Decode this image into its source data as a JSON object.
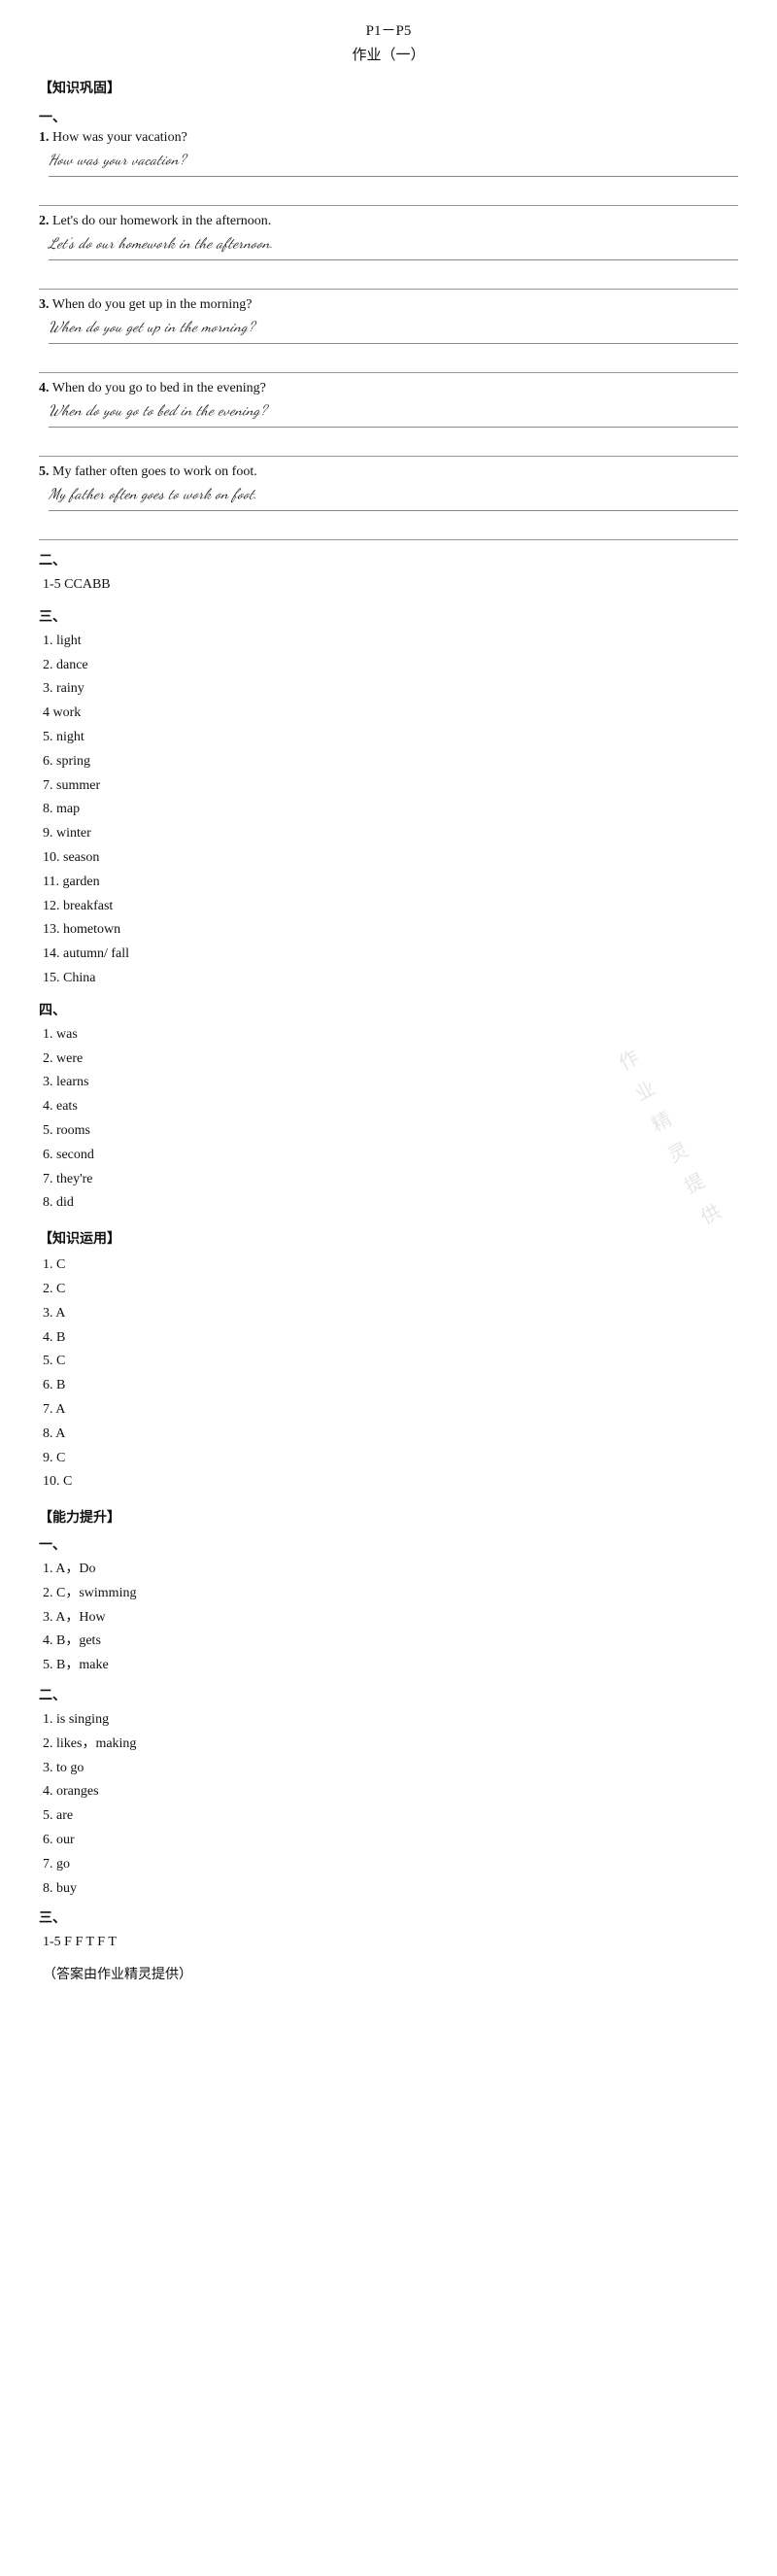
{
  "header": {
    "line1": "P1－P5",
    "line2": "作业（一）"
  },
  "sections": {
    "zhishi_baotu": "【知识巩固】",
    "yi_label": "一、",
    "questions": [
      {
        "num": "1.",
        "text": "How was your vacation?",
        "answer": "How was your vacation?"
      },
      {
        "num": "2.",
        "text": "Let's do our homework in the afternoon.",
        "answer": "Let's do our homework in the afternoon."
      },
      {
        "num": "3.",
        "text": "When do you get up in the morning?",
        "answer": "When do you get up in the morning?"
      },
      {
        "num": "4.",
        "text": "When do you go to bed in the evening?",
        "answer": "When do you go to bed in the evening?"
      },
      {
        "num": "5.",
        "text": "My father often goes to work on foot.",
        "answer": "My father often goes to work on foot."
      }
    ],
    "er_label": "二、",
    "er_answer": "1-5 CCABB",
    "san_label": "三、",
    "san_items": [
      "1. light",
      "2. dance",
      "3. rainy",
      "4 work",
      "5. night",
      "6. spring",
      "7. summer",
      "8. map",
      "9. winter",
      "10. season",
      "11. garden",
      "12. breakfast",
      "13. hometown",
      "14. autumn/ fall",
      "15. China"
    ],
    "si_label": "四、",
    "si_items": [
      "1. was",
      "2. were",
      "3. learns",
      "4. eats",
      "5. rooms",
      "6. second",
      "7. they're",
      "8. did"
    ],
    "zhishi_yunyong": "【知识运用】",
    "yunyong_items": [
      "1. C",
      "2. C",
      "3. A",
      "4. B",
      "5. C",
      "6. B",
      "7. A",
      "8. A",
      "9. C",
      "10. C"
    ],
    "nengli_tisheng": "【能力提升】",
    "neng_yi_label": "一、",
    "neng_yi_items": [
      "1. A，Do",
      "2. C，swimming",
      "3. A，How",
      "4. B，gets",
      "5. B，make"
    ],
    "neng_er_label": "二、",
    "neng_er_items": [
      "1. is singing",
      "2. likes，making",
      "3. to go",
      "4. oranges",
      "5. are",
      "6. our",
      "7. go",
      "8. buy"
    ],
    "neng_san_label": "三、",
    "neng_san_answer": "1-5 F F T F T",
    "footer": "（答案由作业精灵提供）"
  }
}
